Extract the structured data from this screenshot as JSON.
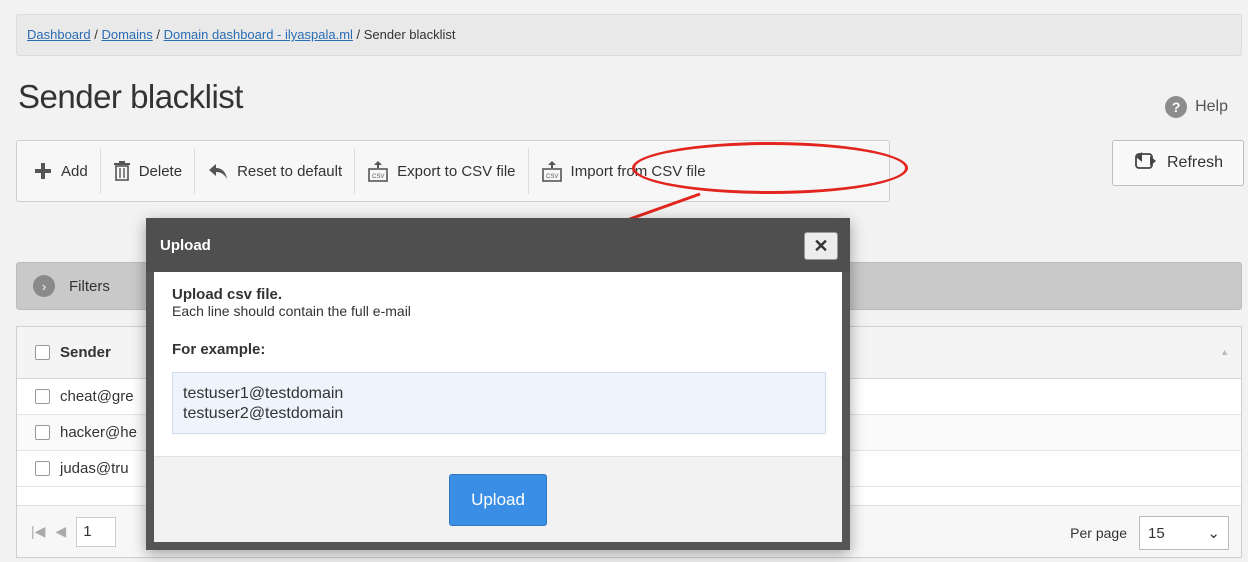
{
  "breadcrumb": {
    "items": [
      "Dashboard",
      "Domains",
      "Domain dashboard - ilyaspala.ml"
    ],
    "current": "Sender blacklist"
  },
  "page": {
    "title": "Sender blacklist",
    "help_label": "Help"
  },
  "toolbar": {
    "add": "Add",
    "delete": "Delete",
    "reset": "Reset to default",
    "export": "Export to CSV file",
    "import": "Import from CSV file",
    "refresh": "Refresh"
  },
  "icons": {
    "add": "plus-icon",
    "delete": "trash-icon",
    "reset": "undo-icon",
    "export": "csv-export-icon",
    "import": "csv-import-icon",
    "refresh": "refresh-icon",
    "help": "question-icon",
    "filters": "chevron-right-icon"
  },
  "filters": {
    "label": "Filters"
  },
  "table": {
    "column": "Sender",
    "rows": [
      "cheat@gre",
      "hacker@he",
      "judas@tru"
    ]
  },
  "pager": {
    "page": "1",
    "per_page_label": "Per page",
    "per_page": "15"
  },
  "modal": {
    "title": "Upload",
    "heading": "Upload csv file.",
    "description": "Each line should contain the full e-mail",
    "example_label": "For example:",
    "examples": [
      "testuser1@testdomain",
      "testuser2@testdomain"
    ],
    "upload_button": "Upload"
  },
  "colors": {
    "accent": "#3a8ee6",
    "highlight": "#e2251f",
    "modal_header": "#4f4f4f"
  }
}
